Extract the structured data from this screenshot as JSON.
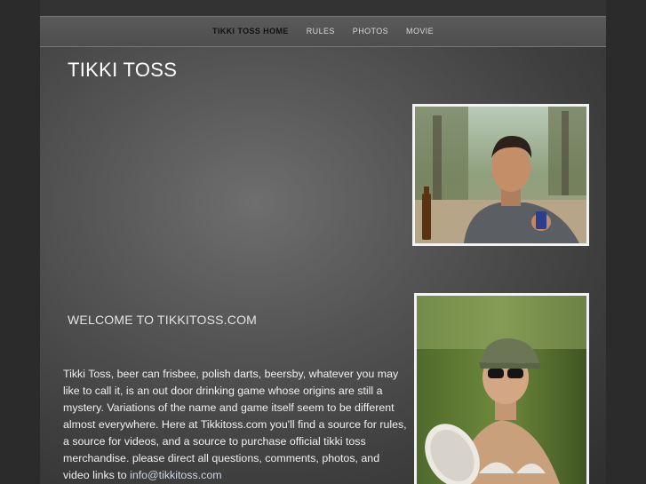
{
  "nav": {
    "items": [
      {
        "label": "TIKKI TOSS HOME",
        "active": true
      },
      {
        "label": "RULES",
        "active": false
      },
      {
        "label": "PHOTOS",
        "active": false
      },
      {
        "label": "MOVIE",
        "active": false
      }
    ]
  },
  "site": {
    "title": "TIKKI TOSS"
  },
  "main": {
    "welcome_heading": "WELCOME TO TIKKITOSS.COM",
    "intro_text": "Tikki Toss, beer can frisbee, polish darts, beersby, whatever you may like to call it, is an out door drinking game whose origins are still a mystery.  Variations of the name and game itself seem to be different almost everywhere.   Here at Tikkitoss.com you'll find a source for rules, a source for videos, and a source to purchase official tikki toss merchandise.  please direct all questions, comments, photos, and video links to ",
    "email": "info@tikkitoss.com"
  },
  "colors": {
    "background": "#2b2b2b",
    "panel": "#555555",
    "nav_bar": "#545454",
    "active_nav": "#111111",
    "text": "#ffffff"
  }
}
